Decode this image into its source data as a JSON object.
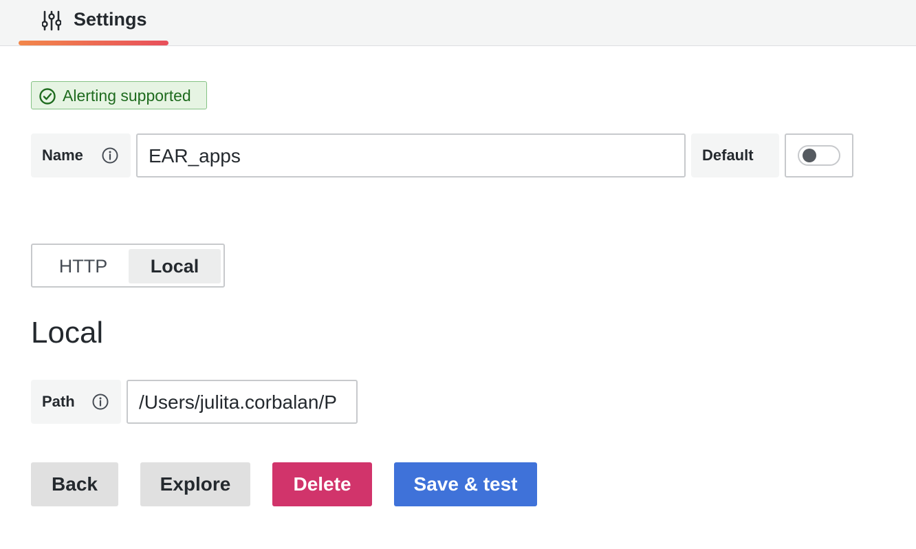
{
  "header": {
    "tab_label": "Settings",
    "tab_icon": "sliders-icon",
    "accent_gradient": [
      "#f2874a",
      "#e84f5b"
    ]
  },
  "badge": {
    "label": "Alerting supported",
    "icon": "check-circle-icon",
    "color": "#1e6b1e"
  },
  "name_field": {
    "label": "Name",
    "value": "EAR_apps",
    "info_icon": "info-icon"
  },
  "default_toggle": {
    "label": "Default",
    "checked": false
  },
  "mode_switch": {
    "options": [
      "HTTP",
      "Local"
    ],
    "selected": "Local"
  },
  "section": {
    "title": "Local"
  },
  "path_field": {
    "label": "Path",
    "value": "/Users/julita.corbalan/P",
    "info_icon": "info-icon"
  },
  "actions": {
    "back": "Back",
    "explore": "Explore",
    "delete": "Delete",
    "save": "Save & test",
    "delete_color": "#d1346b",
    "save_color": "#3f72d9"
  }
}
